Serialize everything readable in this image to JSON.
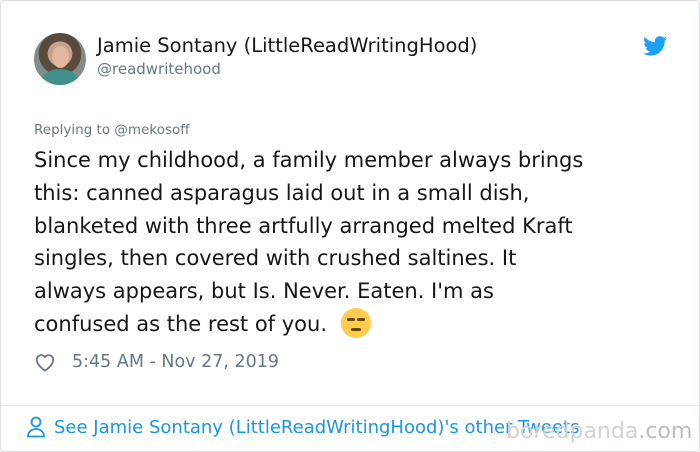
{
  "author": {
    "display_name": "Jamie Sontany (LittleReadWritingHood)",
    "handle": "@readwritehood",
    "avatar_icon": "profile-photo"
  },
  "brand": {
    "icon": "twitter-bird-icon",
    "color": "#1da1f2"
  },
  "tweet": {
    "replying_prefix": "Replying to",
    "replying_to": "@mekosoff",
    "lines": [
      "Since my childhood, a family member always brings",
      "this: canned asparagus laid out in a small dish,",
      "blanketed with three artfully arranged melted Kraft",
      "singles, then covered with crushed saltines.  It",
      "always appears, but Is. Never. Eaten.  I'm as",
      "confused as the rest of you."
    ],
    "emoji": "unamused-face",
    "timestamp": "5:45 AM - Nov 27, 2019"
  },
  "footer": {
    "link_text": "See Jamie Sontany (LittleReadWritingHood)'s other Tweets",
    "link_color": "#1b95e0"
  },
  "watermark": {
    "text": "boredpanda",
    "suffix": ".com"
  }
}
